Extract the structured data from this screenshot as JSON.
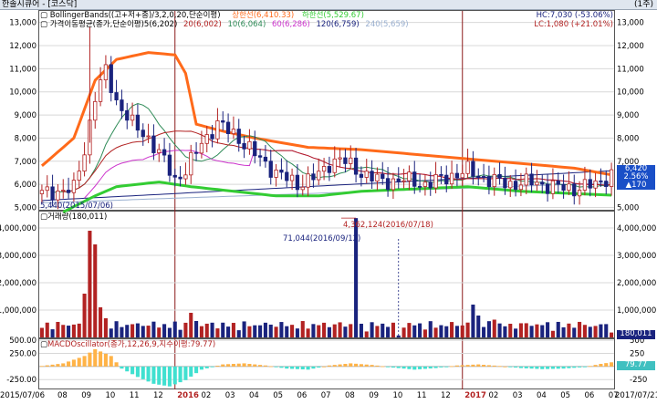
{
  "window": {
    "title": "한솔시큐어 - [코스닥]",
    "period": "(1주)"
  },
  "price_panel": {
    "indicator_line1": {
      "name": "BollingerBands((고+저+종)/3,2,0,20,단순이평)",
      "upper": "상한선(6,410.33)",
      "lower": "하한선(5,529.67)"
    },
    "indicator_line2": {
      "name": "가격이동평균(종가,단순이평)5(6,202)",
      "ma20": "20(6,002)",
      "ma10": "10(6,064)",
      "ma60": "60(6,286)",
      "ma120": "120(6,759)",
      "ma240": "240(5,659)"
    },
    "high": "HC:7,030 (-53.06%)",
    "low": "LC:1,080 (+21.01%)",
    "min_note": "5,440(2015/07/06)",
    "current": {
      "price": "6,420",
      "pct": "2.56%",
      "change": "▲170"
    },
    "yticks": [
      "13,000",
      "12,000",
      "11,000",
      "10,000",
      "9,000",
      "8,000",
      "7,000",
      "6,000",
      "5,000"
    ]
  },
  "volume_panel": {
    "name": "거래량(180,011)",
    "peak_note": "4,362,124(2016/07/18)",
    "low_note": "71,044(2016/09/12)",
    "current": "180,011",
    "yticks": [
      "4,000,000",
      "3,000,000",
      "2,000,000",
      "1,000,000"
    ]
  },
  "macd_panel": {
    "name": "MACDOscillator(종가,12,26,9,지수이평:79.77)",
    "current": "79.77",
    "yticks_l": [
      "500.00",
      "250.00",
      "-250.00"
    ],
    "yticks_r": [
      "500",
      "250",
      "-250"
    ]
  },
  "xaxis": {
    "labels": [
      "2015/07/06",
      "08",
      "09",
      "10",
      "11",
      "12",
      "2016",
      "02",
      "03",
      "04",
      "05",
      "06",
      "07",
      "08",
      "09",
      "10",
      "11",
      "12",
      "2017",
      "02",
      "03",
      "04",
      "05",
      "06",
      "07",
      "2017/07/21"
    ]
  },
  "colors": {
    "up": "#b22222",
    "down": "#1a237e",
    "bollinger": "#ff6a1a",
    "bollinger_lower": "#33cc33",
    "ma5": "#b22222",
    "ma10": "#2e8b57",
    "ma60": "#cc33cc",
    "ma120": "#1a237e",
    "ma240": "#9ab0d0",
    "macd_pos": "#ffb347",
    "macd_neg": "#40e0d0",
    "vline": "#8b1a1a"
  },
  "chart_data": [
    {
      "type": "candlestick",
      "title": "한솔시큐어 - [코스닥]",
      "x_range": [
        "2015/07/06",
        "2017/07/21"
      ],
      "ylim": [
        5000,
        13500
      ],
      "series": [
        {
          "name": "Close",
          "x": [
            "2015/07",
            "2015/09",
            "2015/10",
            "2015/12",
            "2016/01",
            "2016/03",
            "2016/05",
            "2016/07",
            "2016/09",
            "2016/11",
            "2017/01",
            "2017/03",
            "2017/05",
            "2017/07"
          ],
          "values": [
            5600,
            7500,
            10800,
            8000,
            6200,
            8600,
            6200,
            6700,
            6200,
            6100,
            6500,
            6100,
            5900,
            6420
          ]
        },
        {
          "name": "BB upper",
          "values": [
            9000,
            10500,
            11400,
            11600,
            11500,
            8600,
            8000,
            7600,
            7400,
            7200,
            7100,
            6800,
            6600,
            6410
          ]
        },
        {
          "name": "BB lower",
          "values": [
            4800,
            5200,
            5700,
            5800,
            6000,
            5500,
            5400,
            5300,
            5400,
            5500,
            5600,
            5400,
            5400,
            5530
          ]
        }
      ]
    },
    {
      "type": "bar",
      "title": "거래량",
      "ylim": [
        0,
        4600000
      ],
      "series": [
        {
          "name": "Volume",
          "x": [
            "2015/09",
            "2016/07/18",
            "2016/09/12",
            "2017/01",
            "2017/07/21"
          ],
          "values": [
            3900000,
            4362124,
            71044,
            1200000,
            180011
          ]
        }
      ]
    },
    {
      "type": "bar",
      "title": "MACDOscillator",
      "ylim": [
        -400,
        500
      ],
      "series": [
        {
          "name": "Oscillator",
          "x": [
            "2015/09",
            "2016/01",
            "2016/05",
            "2016/09",
            "2017/01",
            "2017/05",
            "2017/07"
          ],
          "values": [
            320,
            -380,
            60,
            -60,
            40,
            -50,
            79.77
          ]
        }
      ]
    }
  ]
}
